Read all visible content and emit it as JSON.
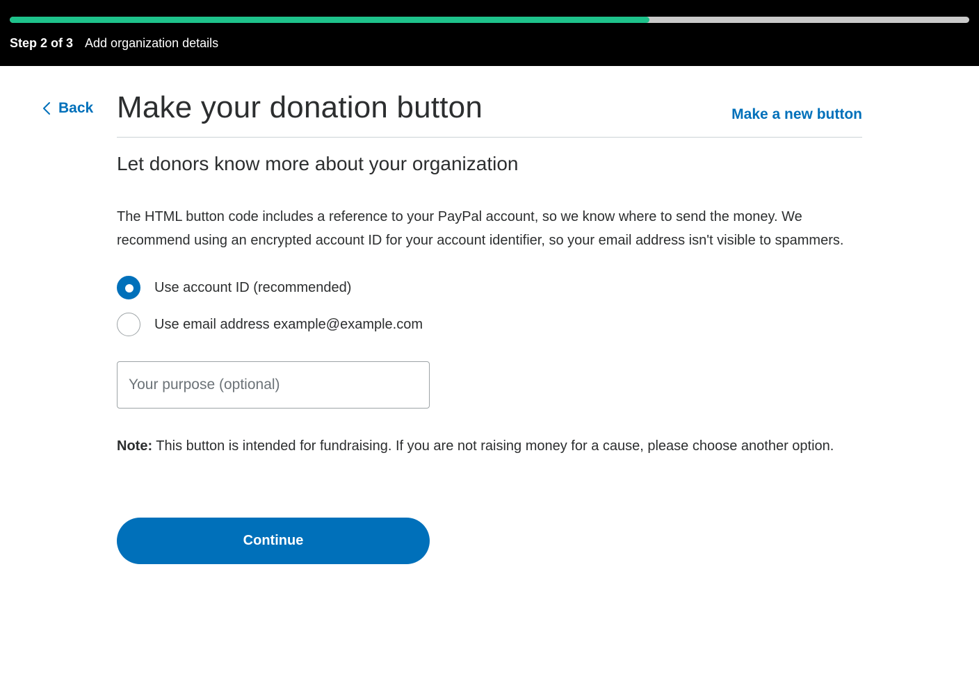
{
  "header": {
    "progress": 0.667,
    "step_label": "Step 2 of 3",
    "step_title": "Add organization details",
    "colors": {
      "progress_fill": "#1ec28b",
      "progress_track": "#c9c9c9",
      "background": "#000000"
    }
  },
  "nav": {
    "back_label": "Back",
    "back_icon": "chevron-left-icon",
    "new_button_label": "Make a new button"
  },
  "main": {
    "title": "Make your donation button",
    "subtitle": "Let donors know more about your organization",
    "description": "The HTML button code includes a reference to your PayPal account, so we know where to send the money. We recommend using an encrypted account ID for your account identifier, so your email address isn't visible to spammers.",
    "options": [
      {
        "label": "Use account ID (recommended)",
        "checked": true
      },
      {
        "label": "Use email address example@example.com",
        "checked": false
      }
    ],
    "purpose_input": {
      "placeholder": "Your purpose (optional)",
      "value": ""
    },
    "note_label": "Note:",
    "note_text": " This button is intended for fundraising. If you are not raising money for a cause, please choose another option.",
    "continue_label": "Continue",
    "accent_color": "#0070ba"
  }
}
